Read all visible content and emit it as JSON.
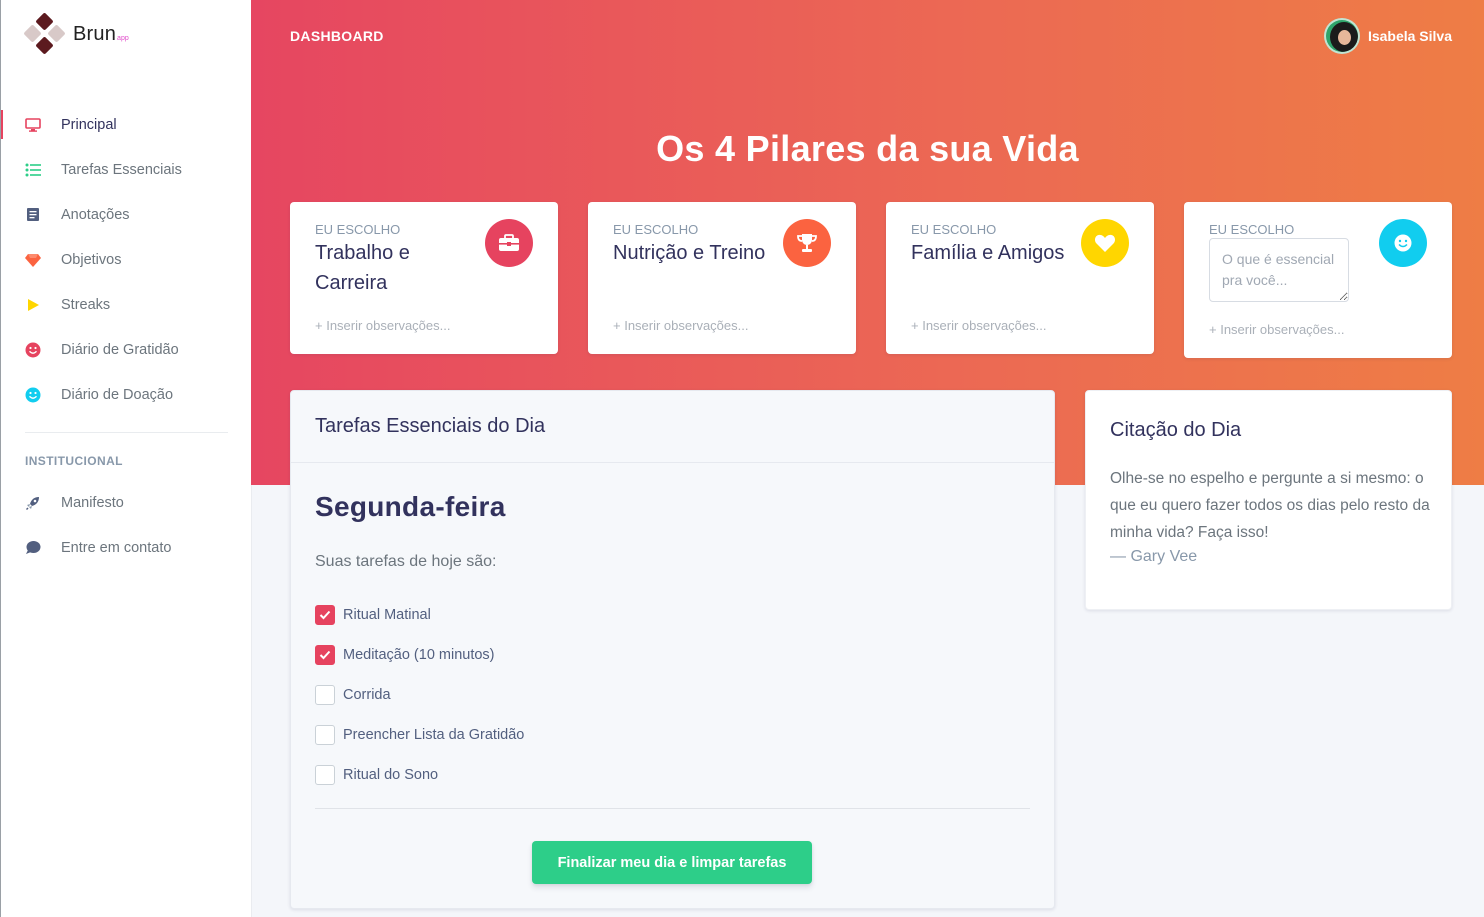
{
  "brand": {
    "name": "Brun",
    "suffix": "app"
  },
  "sidebar": {
    "items": [
      {
        "label": "Principal",
        "icon": "monitor-icon",
        "color": "#e6435f",
        "active": true
      },
      {
        "label": "Tarefas Essenciais",
        "icon": "list-icon",
        "color": "#2dce89"
      },
      {
        "label": "Anotações",
        "icon": "notebook-icon",
        "color": "#525f7f"
      },
      {
        "label": "Objetivos",
        "icon": "diamond-icon",
        "color": "#fb6340"
      },
      {
        "label": "Streaks",
        "icon": "play-icon",
        "color": "#ffd600"
      },
      {
        "label": "Diário de Gratidão",
        "icon": "smile-icon",
        "color": "#e6435f"
      },
      {
        "label": "Diário de Doação",
        "icon": "smile-icon",
        "color": "#11cdef"
      }
    ],
    "heading": "INSTITUCIONAL",
    "institutional": [
      {
        "label": "Manifesto",
        "icon": "rocket-icon",
        "color": "#525f7f"
      },
      {
        "label": "Entre em contato",
        "icon": "chat-bubble-icon",
        "color": "#525f7f"
      }
    ]
  },
  "topbar": {
    "title": "DASHBOARD",
    "user_name": "Isabela Silva"
  },
  "hero": {
    "title": "Os 4 Pilares da sua Vida"
  },
  "pillars": [
    {
      "label": "EU ESCOLHO",
      "title": "Trabalho e Carreira",
      "notes": "+ Inserir observações...",
      "icon": "toolbox-icon",
      "color": "#e6435f"
    },
    {
      "label": "EU ESCOLHO",
      "title": "Nutrição e Treino",
      "notes": "+ Inserir observações...",
      "icon": "trophy-icon",
      "color": "#fb6340"
    },
    {
      "label": "EU ESCOLHO",
      "title": "Família e Amigos",
      "notes": "+ Inserir observações...",
      "icon": "heart-icon",
      "color": "#ffd600"
    },
    {
      "label": "EU ESCOLHO",
      "placeholder": "O que é essencial pra você...",
      "notes": "+ Inserir observações...",
      "icon": "smile-icon",
      "color": "#11cdef"
    }
  ],
  "tasks": {
    "header": "Tarefas Essenciais do Dia",
    "day": "Segunda-feira",
    "intro": "Suas tarefas de hoje são:",
    "items": [
      {
        "label": "Ritual Matinal",
        "checked": true
      },
      {
        "label": "Meditação (10 minutos)",
        "checked": true
      },
      {
        "label": "Corrida",
        "checked": false
      },
      {
        "label": "Preencher Lista da Gratidão",
        "checked": false
      },
      {
        "label": "Ritual do Sono",
        "checked": false
      }
    ],
    "button": "Finalizar meu dia e limpar tarefas"
  },
  "quote": {
    "title": "Citação do Dia",
    "text": "Olhe-se no espelho e pergunte a si mesmo: o que eu quero fazer todos os dias pelo resto da minha vida? Faça isso!",
    "author": "— Gary Vee"
  },
  "colors": {
    "accent": "#e6435f",
    "success": "#2dce89",
    "gradient_start": "#e64661",
    "gradient_end": "#ee7d45"
  }
}
